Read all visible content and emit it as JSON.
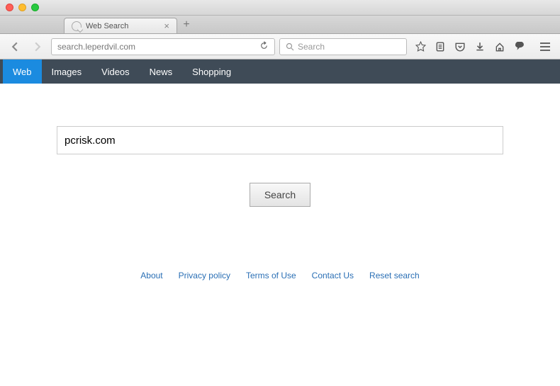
{
  "window": {
    "tab_title": "Web Search",
    "url": "search.leperdvil.com",
    "search_placeholder": "Search"
  },
  "content_nav": {
    "items": [
      {
        "label": "Web",
        "active": true
      },
      {
        "label": "Images",
        "active": false
      },
      {
        "label": "Videos",
        "active": false
      },
      {
        "label": "News",
        "active": false
      },
      {
        "label": "Shopping",
        "active": false
      }
    ]
  },
  "search": {
    "field_value": "pcrisk.com",
    "button_label": "Search"
  },
  "footer": {
    "links": [
      {
        "label": "About"
      },
      {
        "label": "Privacy policy"
      },
      {
        "label": "Terms of Use"
      },
      {
        "label": "Contact Us"
      },
      {
        "label": "Reset search"
      }
    ]
  }
}
